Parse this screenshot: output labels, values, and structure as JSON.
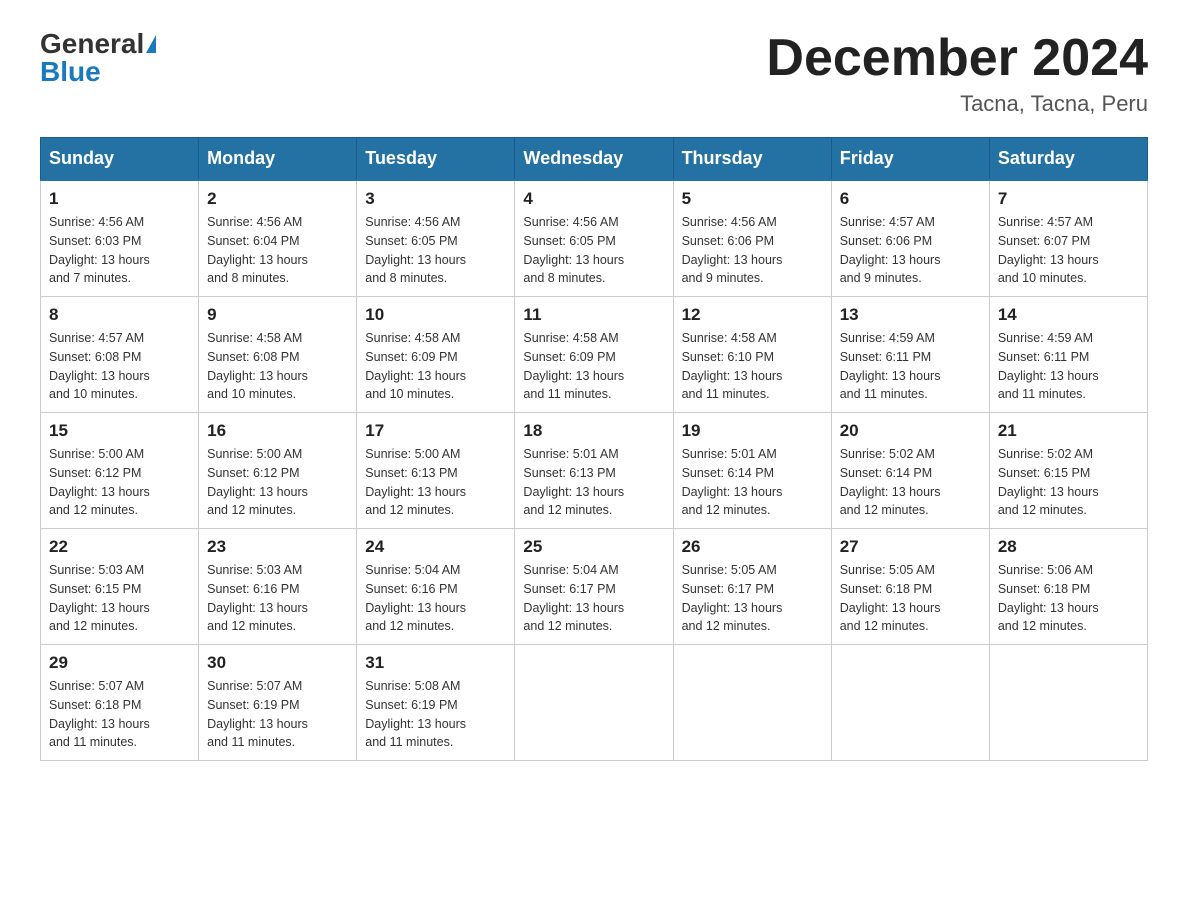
{
  "header": {
    "logo_general": "General",
    "logo_blue": "Blue",
    "month_title": "December 2024",
    "location": "Tacna, Tacna, Peru"
  },
  "days_of_week": [
    "Sunday",
    "Monday",
    "Tuesday",
    "Wednesday",
    "Thursday",
    "Friday",
    "Saturday"
  ],
  "weeks": [
    [
      {
        "day": "1",
        "sunrise": "4:56 AM",
        "sunset": "6:03 PM",
        "daylight": "13 hours and 7 minutes."
      },
      {
        "day": "2",
        "sunrise": "4:56 AM",
        "sunset": "6:04 PM",
        "daylight": "13 hours and 8 minutes."
      },
      {
        "day": "3",
        "sunrise": "4:56 AM",
        "sunset": "6:05 PM",
        "daylight": "13 hours and 8 minutes."
      },
      {
        "day": "4",
        "sunrise": "4:56 AM",
        "sunset": "6:05 PM",
        "daylight": "13 hours and 8 minutes."
      },
      {
        "day": "5",
        "sunrise": "4:56 AM",
        "sunset": "6:06 PM",
        "daylight": "13 hours and 9 minutes."
      },
      {
        "day": "6",
        "sunrise": "4:57 AM",
        "sunset": "6:06 PM",
        "daylight": "13 hours and 9 minutes."
      },
      {
        "day": "7",
        "sunrise": "4:57 AM",
        "sunset": "6:07 PM",
        "daylight": "13 hours and 10 minutes."
      }
    ],
    [
      {
        "day": "8",
        "sunrise": "4:57 AM",
        "sunset": "6:08 PM",
        "daylight": "13 hours and 10 minutes."
      },
      {
        "day": "9",
        "sunrise": "4:58 AM",
        "sunset": "6:08 PM",
        "daylight": "13 hours and 10 minutes."
      },
      {
        "day": "10",
        "sunrise": "4:58 AM",
        "sunset": "6:09 PM",
        "daylight": "13 hours and 10 minutes."
      },
      {
        "day": "11",
        "sunrise": "4:58 AM",
        "sunset": "6:09 PM",
        "daylight": "13 hours and 11 minutes."
      },
      {
        "day": "12",
        "sunrise": "4:58 AM",
        "sunset": "6:10 PM",
        "daylight": "13 hours and 11 minutes."
      },
      {
        "day": "13",
        "sunrise": "4:59 AM",
        "sunset": "6:11 PM",
        "daylight": "13 hours and 11 minutes."
      },
      {
        "day": "14",
        "sunrise": "4:59 AM",
        "sunset": "6:11 PM",
        "daylight": "13 hours and 11 minutes."
      }
    ],
    [
      {
        "day": "15",
        "sunrise": "5:00 AM",
        "sunset": "6:12 PM",
        "daylight": "13 hours and 12 minutes."
      },
      {
        "day": "16",
        "sunrise": "5:00 AM",
        "sunset": "6:12 PM",
        "daylight": "13 hours and 12 minutes."
      },
      {
        "day": "17",
        "sunrise": "5:00 AM",
        "sunset": "6:13 PM",
        "daylight": "13 hours and 12 minutes."
      },
      {
        "day": "18",
        "sunrise": "5:01 AM",
        "sunset": "6:13 PM",
        "daylight": "13 hours and 12 minutes."
      },
      {
        "day": "19",
        "sunrise": "5:01 AM",
        "sunset": "6:14 PM",
        "daylight": "13 hours and 12 minutes."
      },
      {
        "day": "20",
        "sunrise": "5:02 AM",
        "sunset": "6:14 PM",
        "daylight": "13 hours and 12 minutes."
      },
      {
        "day": "21",
        "sunrise": "5:02 AM",
        "sunset": "6:15 PM",
        "daylight": "13 hours and 12 minutes."
      }
    ],
    [
      {
        "day": "22",
        "sunrise": "5:03 AM",
        "sunset": "6:15 PM",
        "daylight": "13 hours and 12 minutes."
      },
      {
        "day": "23",
        "sunrise": "5:03 AM",
        "sunset": "6:16 PM",
        "daylight": "13 hours and 12 minutes."
      },
      {
        "day": "24",
        "sunrise": "5:04 AM",
        "sunset": "6:16 PM",
        "daylight": "13 hours and 12 minutes."
      },
      {
        "day": "25",
        "sunrise": "5:04 AM",
        "sunset": "6:17 PM",
        "daylight": "13 hours and 12 minutes."
      },
      {
        "day": "26",
        "sunrise": "5:05 AM",
        "sunset": "6:17 PM",
        "daylight": "13 hours and 12 minutes."
      },
      {
        "day": "27",
        "sunrise": "5:05 AM",
        "sunset": "6:18 PM",
        "daylight": "13 hours and 12 minutes."
      },
      {
        "day": "28",
        "sunrise": "5:06 AM",
        "sunset": "6:18 PM",
        "daylight": "13 hours and 12 minutes."
      }
    ],
    [
      {
        "day": "29",
        "sunrise": "5:07 AM",
        "sunset": "6:18 PM",
        "daylight": "13 hours and 11 minutes."
      },
      {
        "day": "30",
        "sunrise": "5:07 AM",
        "sunset": "6:19 PM",
        "daylight": "13 hours and 11 minutes."
      },
      {
        "day": "31",
        "sunrise": "5:08 AM",
        "sunset": "6:19 PM",
        "daylight": "13 hours and 11 minutes."
      },
      null,
      null,
      null,
      null
    ]
  ],
  "labels": {
    "sunrise_prefix": "Sunrise: ",
    "sunset_prefix": "Sunset: ",
    "daylight_prefix": "Daylight: "
  }
}
